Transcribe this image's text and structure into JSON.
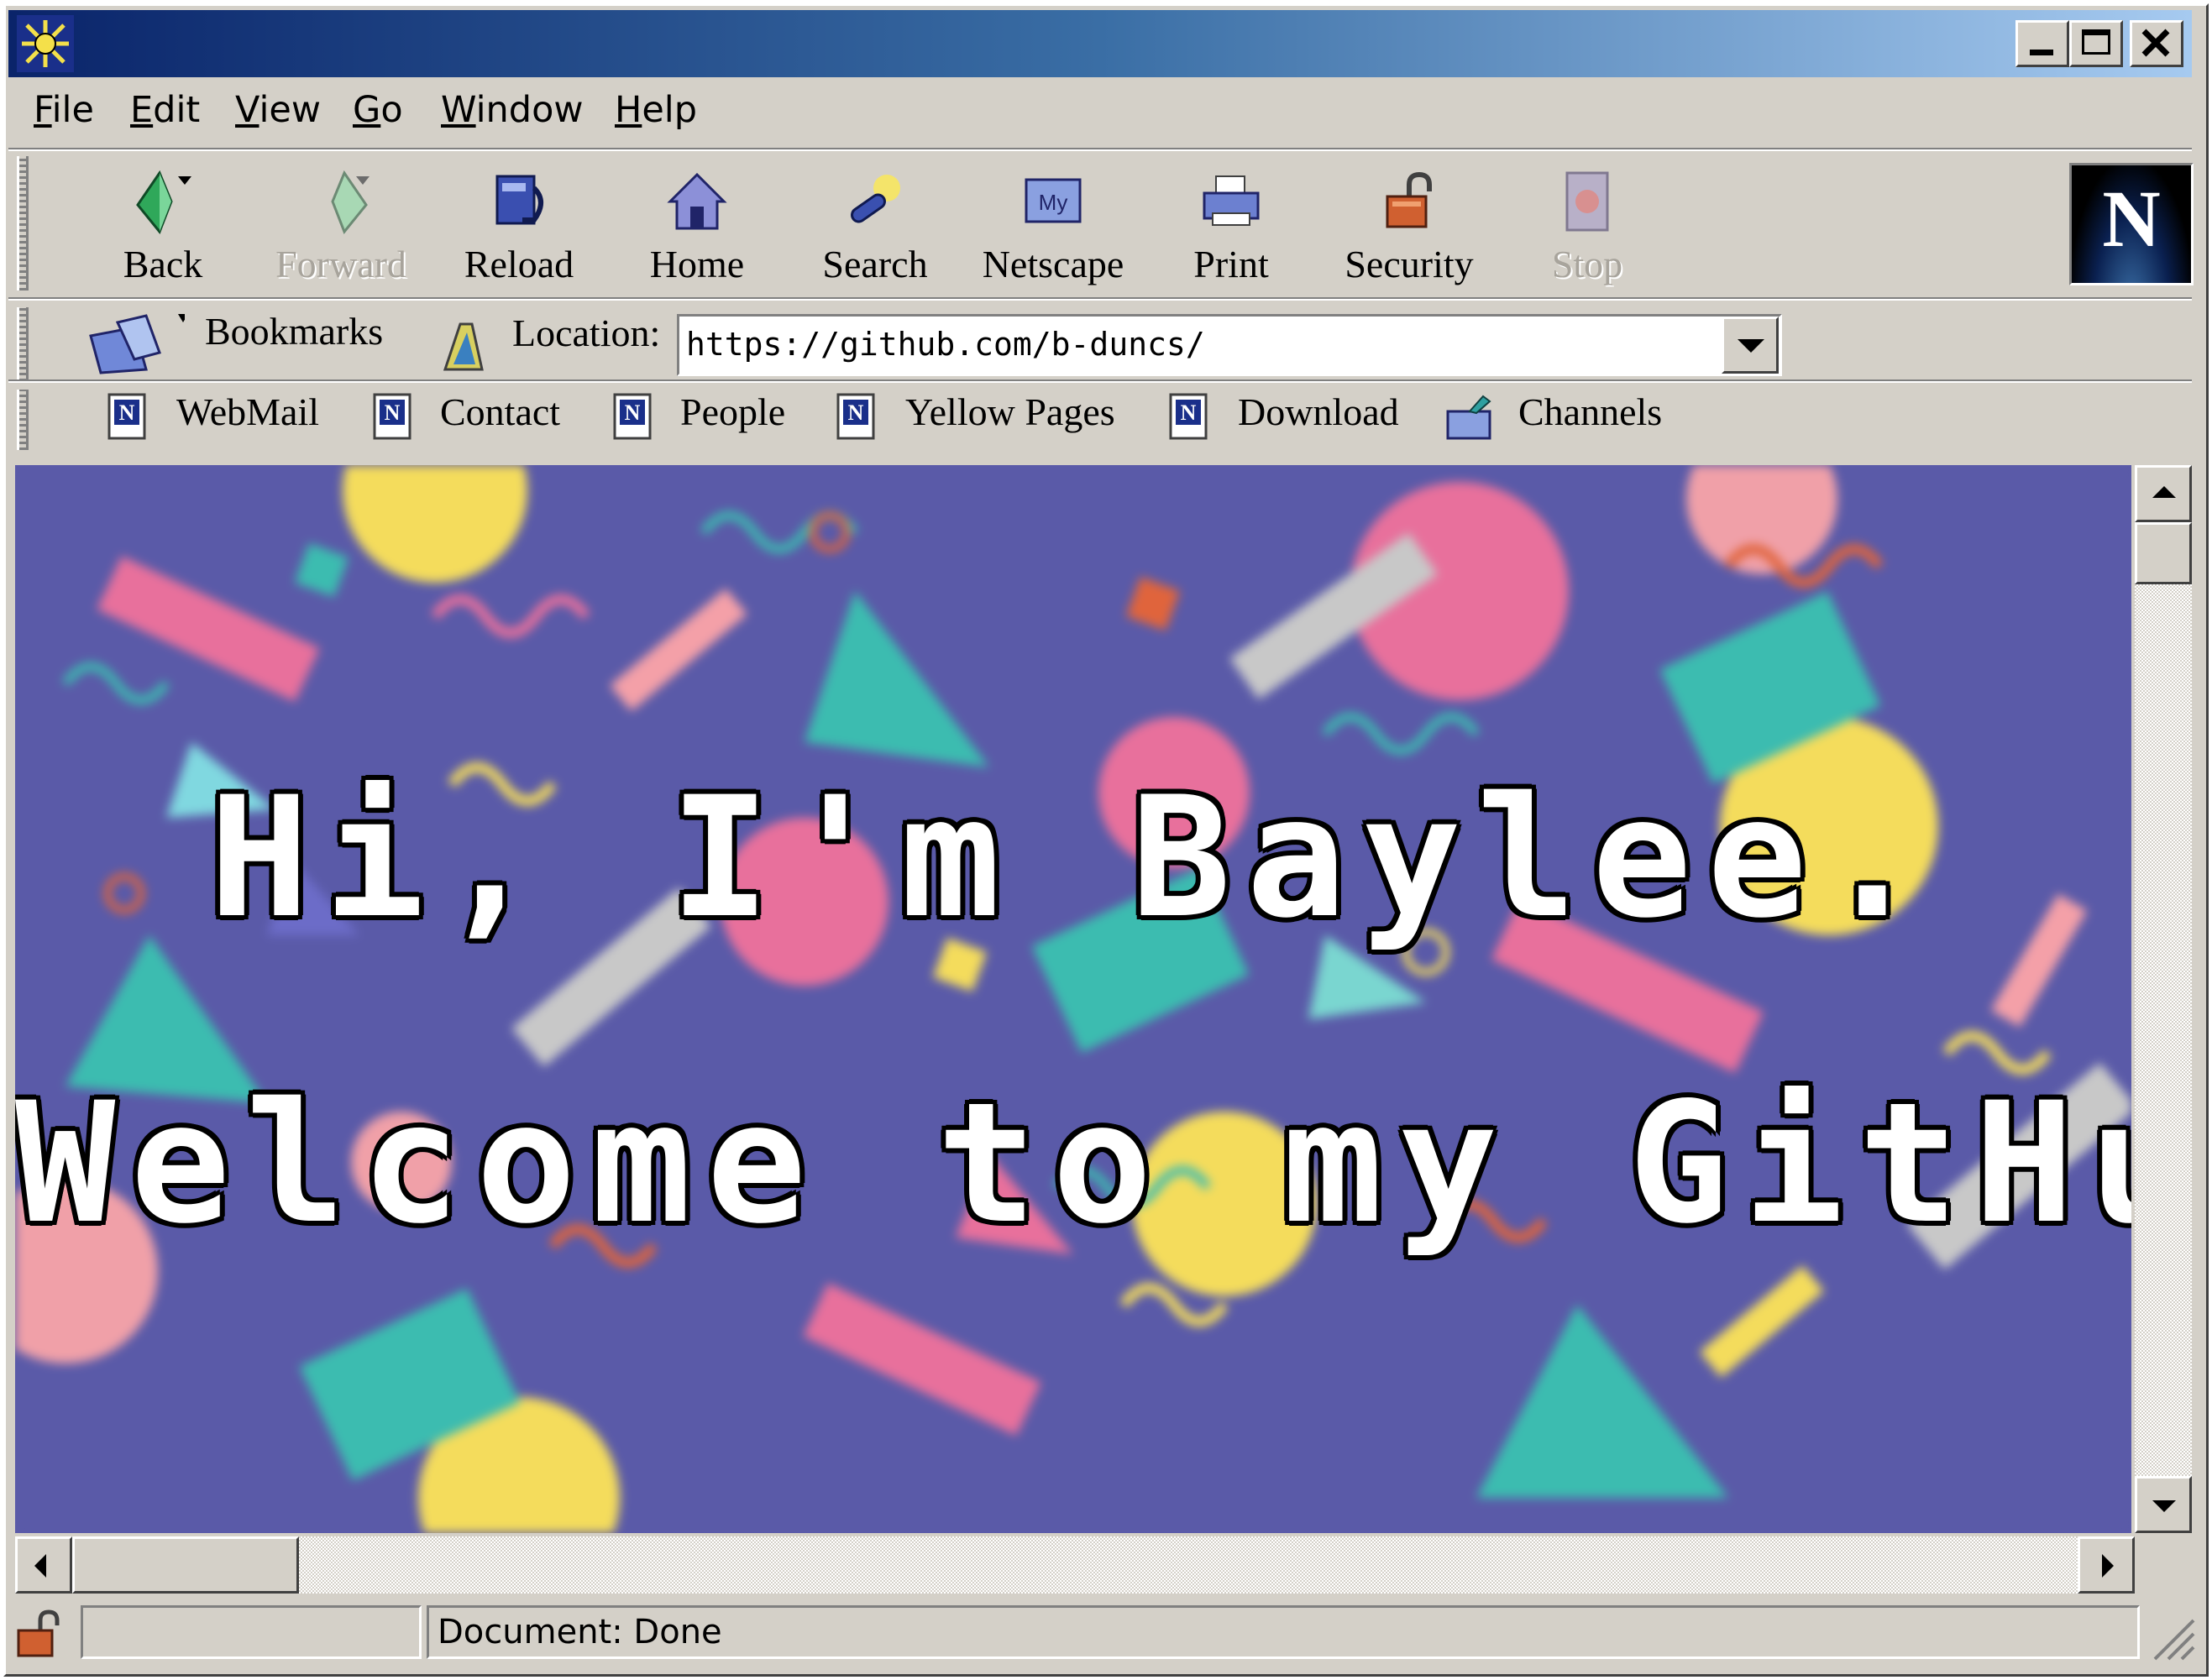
{
  "window": {
    "title": ""
  },
  "menu": {
    "file": "File",
    "edit": "Edit",
    "view": "View",
    "go": "Go",
    "window": "Window",
    "help": "Help"
  },
  "toolbar": {
    "back": "Back",
    "forward": "Forward",
    "reload": "Reload",
    "home": "Home",
    "search": "Search",
    "netscape": "Netscape",
    "print": "Print",
    "security": "Security",
    "stop": "Stop"
  },
  "location_bar": {
    "bookmarks": "Bookmarks",
    "location_label": "Location:",
    "url": "https://github.com/b-duncs/"
  },
  "personal_toolbar": {
    "webmail": "WebMail",
    "contact": "Contact",
    "people": "People",
    "yellow_pages": "Yellow Pages",
    "download": "Download",
    "channels": "Channels"
  },
  "page": {
    "heading_line1": "Hi, I'm Baylee.",
    "heading_line2": "Welcome to my GitHub."
  },
  "status": {
    "text": "Document: Done"
  },
  "colors": {
    "title_start": "#0a246a",
    "title_end": "#a6caf0",
    "chrome": "#d4d0c8",
    "page_bg": "#5a5aa8",
    "teal": "#3cbcb0",
    "pink": "#e8709c",
    "yellow": "#f4dc5c"
  },
  "icons": [
    "netscape-app-icon",
    "back-icon",
    "forward-icon",
    "reload-icon",
    "home-icon",
    "search-icon",
    "my-netscape-icon",
    "print-icon",
    "security-lock-icon",
    "stop-icon",
    "netscape-n-logo",
    "bookmarks-icon",
    "location-icon",
    "bookmark-page-icon",
    "channels-icon",
    "security-status-icon"
  ]
}
